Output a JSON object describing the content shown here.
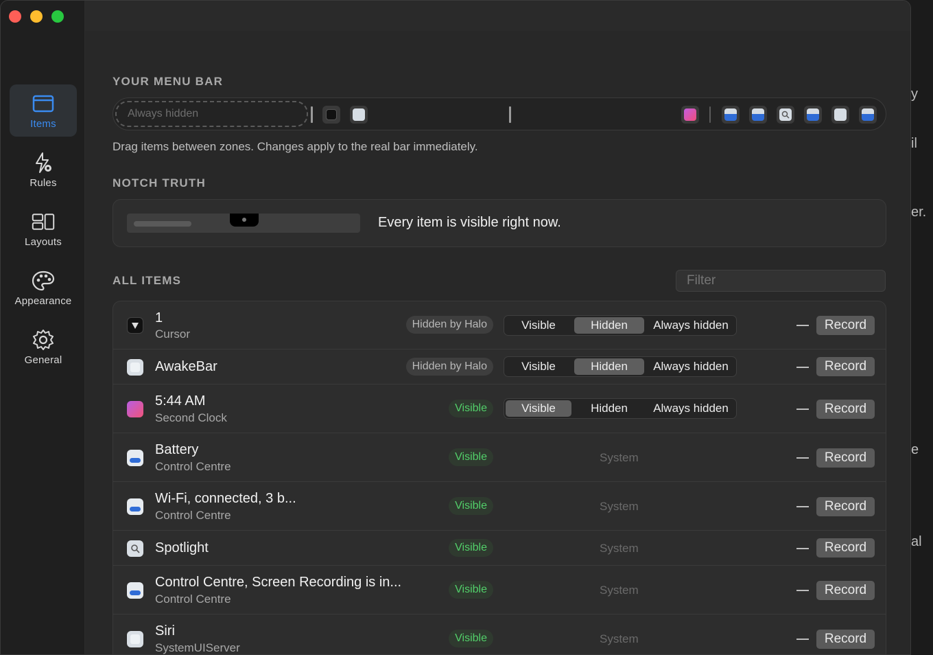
{
  "background_fragments": [
    "y",
    "il",
    "er.",
    "e",
    "al"
  ],
  "window": {
    "traffic_lights": [
      "close",
      "minimize",
      "zoom"
    ]
  },
  "sidebar": {
    "items": [
      {
        "label": "Items",
        "icon": "window-icon",
        "active": true
      },
      {
        "label": "Rules",
        "icon": "bolt-gear-icon",
        "active": false
      },
      {
        "label": "Layouts",
        "icon": "layout-icon",
        "active": false
      },
      {
        "label": "Appearance",
        "icon": "palette-icon",
        "active": false
      },
      {
        "label": "General",
        "icon": "gear-icon",
        "active": false
      }
    ]
  },
  "menu_bar": {
    "section_label": "YOUR MENU BAR",
    "always_hidden_placeholder": "Always hidden",
    "hint": "Drag items between zones. Changes apply to the real bar immediately."
  },
  "notch": {
    "section_label": "NOTCH TRUTH",
    "message": "Every item is visible right now."
  },
  "all_items": {
    "section_label": "ALL ITEMS",
    "filter_placeholder": "Filter",
    "segments": [
      "Visible",
      "Hidden",
      "Always hidden"
    ],
    "record_label": "Record",
    "system_label": "System",
    "rows": [
      {
        "title": "1",
        "subtitle": "Cursor",
        "icon": "cursor-app-icon",
        "badge": "Hidden by Halo",
        "badge_type": "halo",
        "selected": "Hidden"
      },
      {
        "title": "AwakeBar",
        "subtitle": "",
        "icon": "awakebar-icon",
        "badge": "Hidden by Halo",
        "badge_type": "halo",
        "selected": "Hidden"
      },
      {
        "title": "5:44 AM",
        "subtitle": "Second Clock",
        "icon": "second-clock-icon",
        "badge": "Visible",
        "badge_type": "visible",
        "selected": "Visible"
      },
      {
        "title": "Battery",
        "subtitle": "Control Centre",
        "icon": "control-centre-icon",
        "badge": "Visible",
        "badge_type": "visible",
        "selected": "System"
      },
      {
        "title": "Wi-Fi, connected, 3 b...",
        "subtitle": "Control Centre",
        "icon": "control-centre-icon",
        "badge": "Visible",
        "badge_type": "visible",
        "selected": "System"
      },
      {
        "title": "Spotlight",
        "subtitle": "",
        "icon": "spotlight-icon",
        "badge": "Visible",
        "badge_type": "visible",
        "selected": "System"
      },
      {
        "title": "Control Centre, Screen Recording is in...",
        "subtitle": "Control Centre",
        "icon": "control-centre-icon",
        "badge": "Visible",
        "badge_type": "visible",
        "selected": "System"
      },
      {
        "title": "Siri",
        "subtitle": "SystemUIServer",
        "icon": "siri-icon",
        "badge": "Visible",
        "badge_type": "visible",
        "selected": "System"
      }
    ]
  },
  "colors": {
    "accent": "#3a8bf0",
    "visible_green": "#52d06a"
  }
}
